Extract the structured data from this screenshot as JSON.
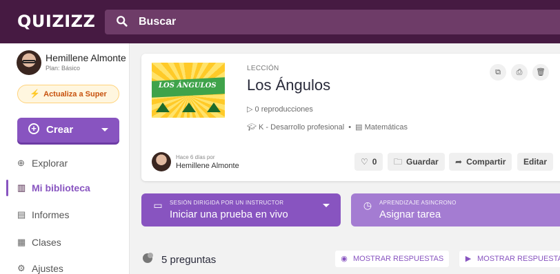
{
  "header": {
    "logo": "QUIZIZZ",
    "search_label": "Buscar",
    "search_icon": "search-icon"
  },
  "colors": {
    "topbar": "#461a42",
    "search_bg": "#6e3c68",
    "accent": "#8854c0",
    "accent_light": "#a47cd2"
  },
  "user": {
    "name": "Hemillene Almonte",
    "plan": "Plan: Básico",
    "upgrade_label": "Actualiza a Super"
  },
  "sidebar": {
    "create_label": "Crear",
    "items": [
      {
        "label": "Explorar",
        "icon": "compass-icon"
      },
      {
        "label": "Mi biblioteca",
        "icon": "library-icon"
      },
      {
        "label": "Informes",
        "icon": "chart-icon"
      },
      {
        "label": "Clases",
        "icon": "class-icon"
      },
      {
        "label": "Ajustes",
        "icon": "gear-icon"
      }
    ]
  },
  "lesson": {
    "thumbnail_text": "LOS ÁNGULOS",
    "kicker": "LECCIÓN",
    "title": "Los Ángulos",
    "plays": "0 reproducciones",
    "grade": "K - Desarrollo profesional",
    "subject": "Matemáticas",
    "author_time": "Hace 6 días por",
    "author_name": "Hemillene Almonte",
    "likes": "0",
    "save_label": "Guardar",
    "share_label": "Compartir",
    "edit_label": "Editar"
  },
  "live": {
    "caption": "SESIÓN DIRIGIDA POR UN INSTRUCTOR",
    "label": "Iniciar una prueba en vivo"
  },
  "assign": {
    "caption": "APRENDIZAJE ASINCRONO",
    "label": "Asignar tarea"
  },
  "questions": {
    "count": "5 preguntas",
    "show_answers_1": "MOSTRAR RESPUESTAS",
    "show_answers_2": "MOSTRAR RESPUESTAS"
  }
}
